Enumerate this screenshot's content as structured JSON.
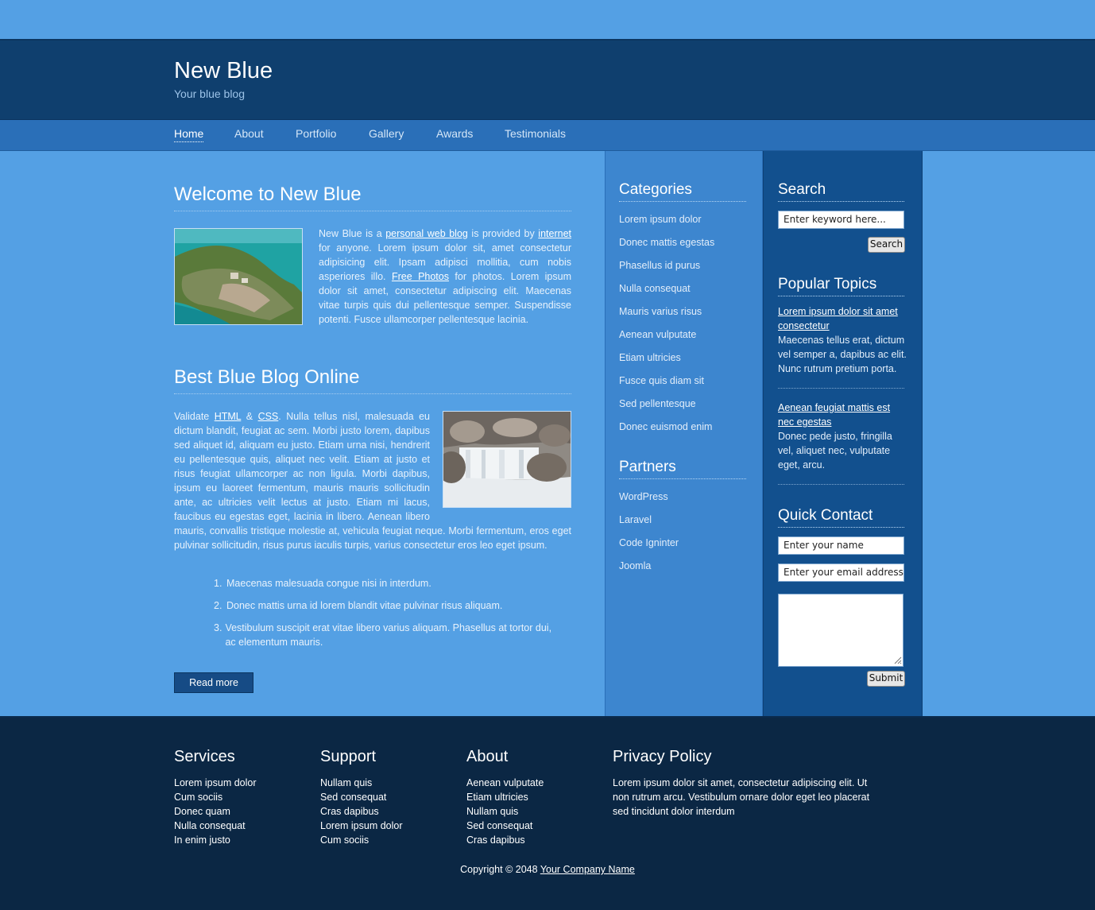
{
  "header": {
    "title": "New Blue",
    "tagline": "Your blue blog"
  },
  "nav": {
    "items": [
      "Home",
      "About",
      "Portfolio",
      "Gallery",
      "Awards",
      "Testimonials"
    ],
    "active": "Home"
  },
  "posts": [
    {
      "title": "Welcome to New Blue",
      "text": {
        "p1": "New Blue is a ",
        "link1": "personal web blog",
        "p2": " is provided by ",
        "link2": "internet",
        "p3": " for anyone. Lorem ipsum dolor sit, amet consectetur adipisicing elit. Ipsam adipisci mollitia, cum nobis asperiores illo. ",
        "link3": "Free Photos",
        "p4": " for photos. Lorem ipsum dolor sit amet, consectetur adipiscing elit. Maecenas vitae turpis quis dui pellentesque semper. Suspendisse potenti. Fusce ullamcorper pellentesque lacinia."
      },
      "image": "island-photo"
    },
    {
      "title": "Best Blue Blog Online",
      "text": {
        "p1": "Validate ",
        "link1": "HTML",
        "p2": " & ",
        "link2": "CSS",
        "p3": ". Nulla tellus nisl, malesuada eu dictum blandit, feugiat ac sem. Morbi justo lorem, dapibus sed aliquet id, aliquam eu justo. Etiam urna nisi, hendrerit eu pellentesque quis, aliquet nec velit. Etiam at justo et risus feugiat ullamcorper ac non ligula. Morbi dapibus, ipsum eu laoreet fermentum, mauris mauris sollicitudin ante, ac ultricies velit lectus at justo. Etiam mi lacus, faucibus eu egestas eget, lacinia in libero. Aenean libero mauris, convallis tristique molestie at, vehicula feugiat neque. Morbi fermentum, eros eget pulvinar sollicitudin, risus purus iaculis turpis, varius consectetur eros leo eget ipsum."
      },
      "image": "waterfall-photo",
      "list": [
        "Maecenas malesuada congue nisi in interdum.",
        "Donec mattis urna id lorem blandit vitae pulvinar risus aliquam.",
        "Vestibulum suscipit erat vitae libero varius aliquam. Phasellus at tortor dui, ac elementum mauris."
      ],
      "read_more": "Read more"
    }
  ],
  "categories": {
    "title": "Categories",
    "items": [
      "Lorem ipsum dolor",
      "Donec mattis egestas",
      "Phasellus id purus",
      "Nulla consequat",
      "Mauris varius risus",
      "Aenean vulputate",
      "Etiam ultricies",
      "Fusce quis diam sit",
      "Sed pellentesque",
      "Donec euismod enim"
    ]
  },
  "partners": {
    "title": "Partners",
    "items": [
      "WordPress",
      "Laravel",
      "Code Igninter",
      "Joomla"
    ]
  },
  "search": {
    "title": "Search",
    "placeholder": "Enter keyword here...",
    "button": "Search"
  },
  "popular": {
    "title": "Popular Topics",
    "items": [
      {
        "link": "Lorem ipsum dolor sit amet consectetur",
        "text": "Maecenas tellus erat, dictum vel semper a, dapibus ac elit. Nunc rutrum pretium porta."
      },
      {
        "link": "Aenean feugiat mattis est nec egestas",
        "text": "Donec pede justo, fringilla vel, aliquet nec, vulputate eget, arcu."
      }
    ]
  },
  "contact": {
    "title": "Quick Contact",
    "name_value": "Enter your name",
    "email_value": "Enter your email address",
    "message": "",
    "button": "Submit"
  },
  "footer": {
    "services": {
      "title": "Services",
      "items": [
        "Lorem ipsum dolor",
        "Cum sociis",
        "Donec quam",
        "Nulla consequat",
        "In enim justo"
      ]
    },
    "support": {
      "title": "Support",
      "items": [
        "Nullam quis",
        "Sed consequat",
        "Cras dapibus",
        "Lorem ipsum dolor",
        "Cum sociis"
      ]
    },
    "about": {
      "title": "About",
      "items": [
        "Aenean vulputate",
        "Etiam ultricies",
        "Nullam quis",
        "Sed consequat",
        "Cras dapibus"
      ]
    },
    "privacy": {
      "title": "Privacy Policy",
      "text": "Lorem ipsum dolor sit amet, consectetur adipiscing elit. Ut non rutrum arcu. Vestibulum ornare dolor eget leo placerat sed tincidunt dolor interdum"
    },
    "copyright_prefix": "Copyright © 2048 ",
    "company": "Your Company Name"
  },
  "colors": {
    "page_bg": "#54a0e4",
    "header_bg": "#0f3f6e",
    "nav_bg": "#2a6fb8",
    "footer_bg": "#0b2744",
    "sidebar1_bg": "#3d86cf",
    "sidebar2_bg": "#12508e"
  }
}
